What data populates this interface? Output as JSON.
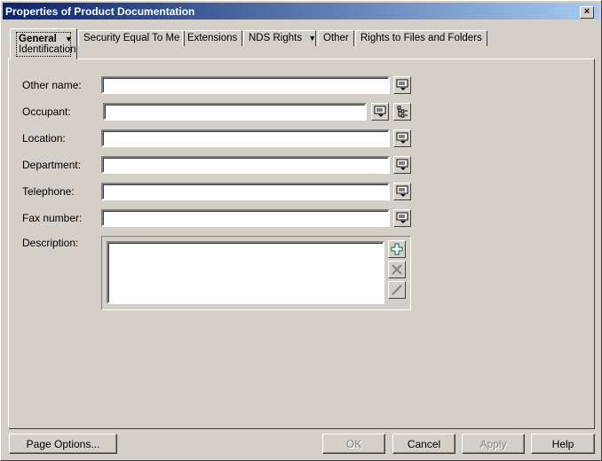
{
  "window": {
    "title": "Properties of Product Documentation",
    "close": "×"
  },
  "tabs": [
    {
      "label": "General",
      "sub": "Identification"
    },
    {
      "label": "Security Equal To Me"
    },
    {
      "label": "Extensions"
    },
    {
      "label": "NDS Rights"
    },
    {
      "label": "Other"
    },
    {
      "label": "Rights to Files and Folders"
    }
  ],
  "fields": [
    {
      "label": "Other name:",
      "value": ""
    },
    {
      "label": "Occupant:",
      "value": ""
    },
    {
      "label": "Location:",
      "value": ""
    },
    {
      "label": "Department:",
      "value": ""
    },
    {
      "label": "Telephone:",
      "value": ""
    },
    {
      "label": "Fax number:",
      "value": ""
    }
  ],
  "description": {
    "label": "Description:",
    "value": ""
  },
  "buttons": {
    "page_options": "Page Options...",
    "ok": "OK",
    "cancel": "Cancel",
    "apply": "Apply",
    "help": "Help"
  }
}
